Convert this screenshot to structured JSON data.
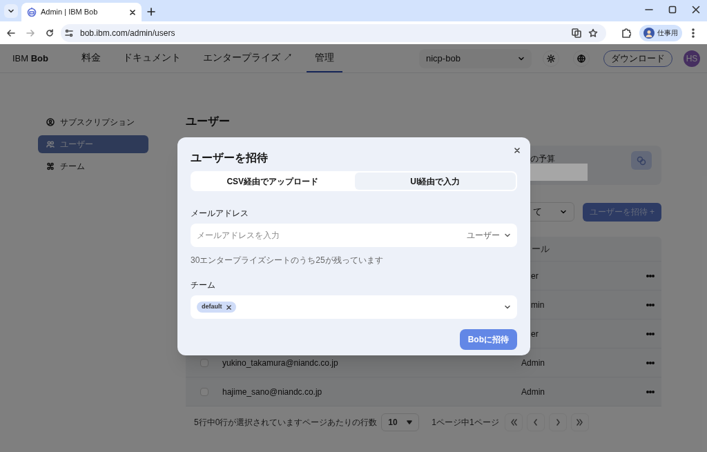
{
  "browser": {
    "tab_title": "Admin | IBM Bob",
    "url": "bob.ibm.com/admin/users",
    "profile": "仕事用"
  },
  "nav": {
    "brand": "IBM **Bob**",
    "items": [
      {
        "label": "料金",
        "selected": false
      },
      {
        "label": "ドキュメント",
        "selected": false
      },
      {
        "label": "エンタープライズ ↗",
        "selected": false
      },
      {
        "label": "管理",
        "selected": true
      }
    ],
    "org_select": "nicp-bob",
    "download": "ダウンロード",
    "avatar": "HS"
  },
  "sidebar": {
    "items": [
      {
        "label": "サブスクリプション",
        "kind": "subscription",
        "selected": false
      },
      {
        "label": "ユーザー",
        "kind": "users",
        "selected": true
      },
      {
        "label": "チーム",
        "kind": "team",
        "selected": false
      }
    ]
  },
  "page": {
    "title": "ユーザー",
    "budget_label": "の予算",
    "filter_value": "て",
    "invite_button": "ユーザーを招待",
    "invite_icon": "+"
  },
  "table": {
    "columns": [
      "ール"
    ],
    "rows": [
      {
        "role": "er"
      },
      {
        "role": "min"
      },
      {
        "role": "er"
      },
      {
        "email": "yukino_takamura@niandc.co.jp",
        "role": "Admin",
        "checked": false
      },
      {
        "email": "hajime_sano@niandc.co.jp",
        "role": "Admin",
        "checked": false
      }
    ]
  },
  "footer": {
    "selection": "5行中0行が選択されています",
    "rows_per_page_label": "ページあたりの行数",
    "rows_per_page": "10",
    "page_info": "1ページ中1ページ"
  },
  "modal": {
    "title": "ユーザーを招待",
    "tabs": [
      {
        "label": "CSV経由でアップロード",
        "selected": false
      },
      {
        "label": "UI経由で入力",
        "selected": true
      }
    ],
    "email_label": "メールアドレス",
    "email_placeholder": "メールアドレスを入力",
    "role": "ユーザー",
    "seats_note": "30エンタープライズシートのうち25が残っています",
    "team_label": "チーム",
    "teams": [
      "default"
    ],
    "submit": "Bobに招待"
  }
}
